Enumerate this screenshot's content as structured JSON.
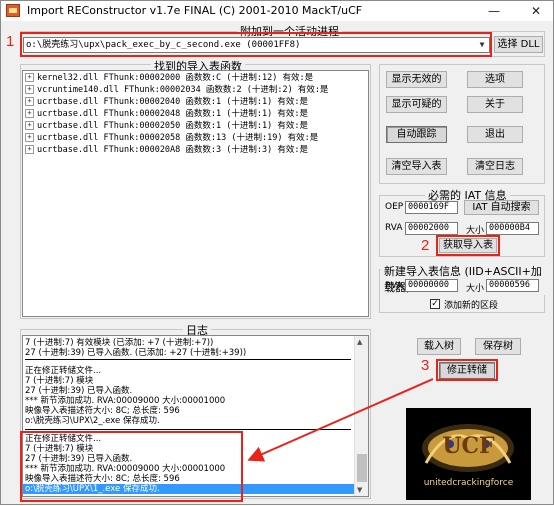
{
  "window": {
    "title": "Import REConstructor v1.7e FINAL (C) 2001-2010 MackT/uCF",
    "minimize": "—",
    "close": "✕"
  },
  "attach": {
    "group_label": "附加到一个活动进程",
    "process_value": "o:\\脱壳练习\\upx\\pack_exec_by_c_second.exe (00001FF8)",
    "select_dll_label": "选择 DLL"
  },
  "imports": {
    "group_label": "找到的导入表函数",
    "rows": [
      "kernel32.dll FThunk:00002000 函数数:C (十进制:12) 有效:是",
      "vcruntime140.dll FThunk:00002034 函数数:2 (十进制:2) 有效:是",
      "ucrtbase.dll FThunk:00002040 函数数:1 (十进制:1) 有效:是",
      "ucrtbase.dll FThunk:00002048 函数数:1 (十进制:1) 有效:是",
      "ucrtbase.dll FThunk:00002050 函数数:1 (十进制:1) 有效:是",
      "ucrtbase.dll FThunk:00002058 函数数:13 (十进制:19) 有效:是",
      "ucrtbase.dll FThunk:000020A8 函数数:3 (十进制:3) 有效:是"
    ]
  },
  "side_buttons": {
    "show_invalid": "显示无效的",
    "options": "选项",
    "show_suspect": "显示可疑的",
    "about": "关于",
    "auto_trace": "自动跟踪",
    "exit": "退出",
    "clear_imports": "清空导入表",
    "clear_log": "清空日志"
  },
  "iat_info": {
    "group_label": "必需的 IAT 信息",
    "oep_label": "OEP",
    "oep_value": "0000169F",
    "iat_autosearch": "IAT 自动搜索",
    "rva_label": "RVA",
    "rva_value": "00002000",
    "size_label": "大小",
    "size_value": "000000B4",
    "get_imports": "获取导入表"
  },
  "new_import": {
    "group_label": "新建导入表信息 (IID+ASCII+加载器)",
    "rva_label": "RVA",
    "rva_value": "00000000",
    "size_label": "大小",
    "size_value": "00000596",
    "add_section_label": "添加新的区段",
    "add_section_checked": "✓"
  },
  "log": {
    "group_label": "日志",
    "top_lines": [
      "7 (十进制:7) 有效模块 (已添加: +7 (十进制:+7))",
      "27 (十进制:39) 已导入函数. (已添加: +27 (十进制:+39))"
    ],
    "middle_lines": [
      "正在修正转储文件...",
      "7 (十进制:7) 模块",
      "27 (十进制:39) 已导入函数.",
      "*** 新节添加成功. RVA:00009000 大小:00001000",
      "映像导入表描述符大小: 8C; 总长度: 596",
      "o:\\脱壳练习\\UPX\\2_.exe 保存成功."
    ],
    "bottom_lines": [
      "正在修正转储文件...",
      "7 (十进制:7) 模块",
      "27 (十进制:39) 已导入函数.",
      "*** 新节添加成功. RVA:00009000 大小:00001000",
      "映像导入表描述符大小: 8C; 总长度: 596"
    ],
    "selected_line": "o:\\脱壳练习\\UPX\\1_.exe 保存成功."
  },
  "tree_buttons": {
    "load_tree": "载入树",
    "save_tree": "保存树",
    "fix_dump": "修正转储"
  },
  "annotations": {
    "one": "1",
    "two": "2",
    "three": "3"
  },
  "logo": {
    "letters": "UCF",
    "tagline": "unitedcrackingforce"
  }
}
